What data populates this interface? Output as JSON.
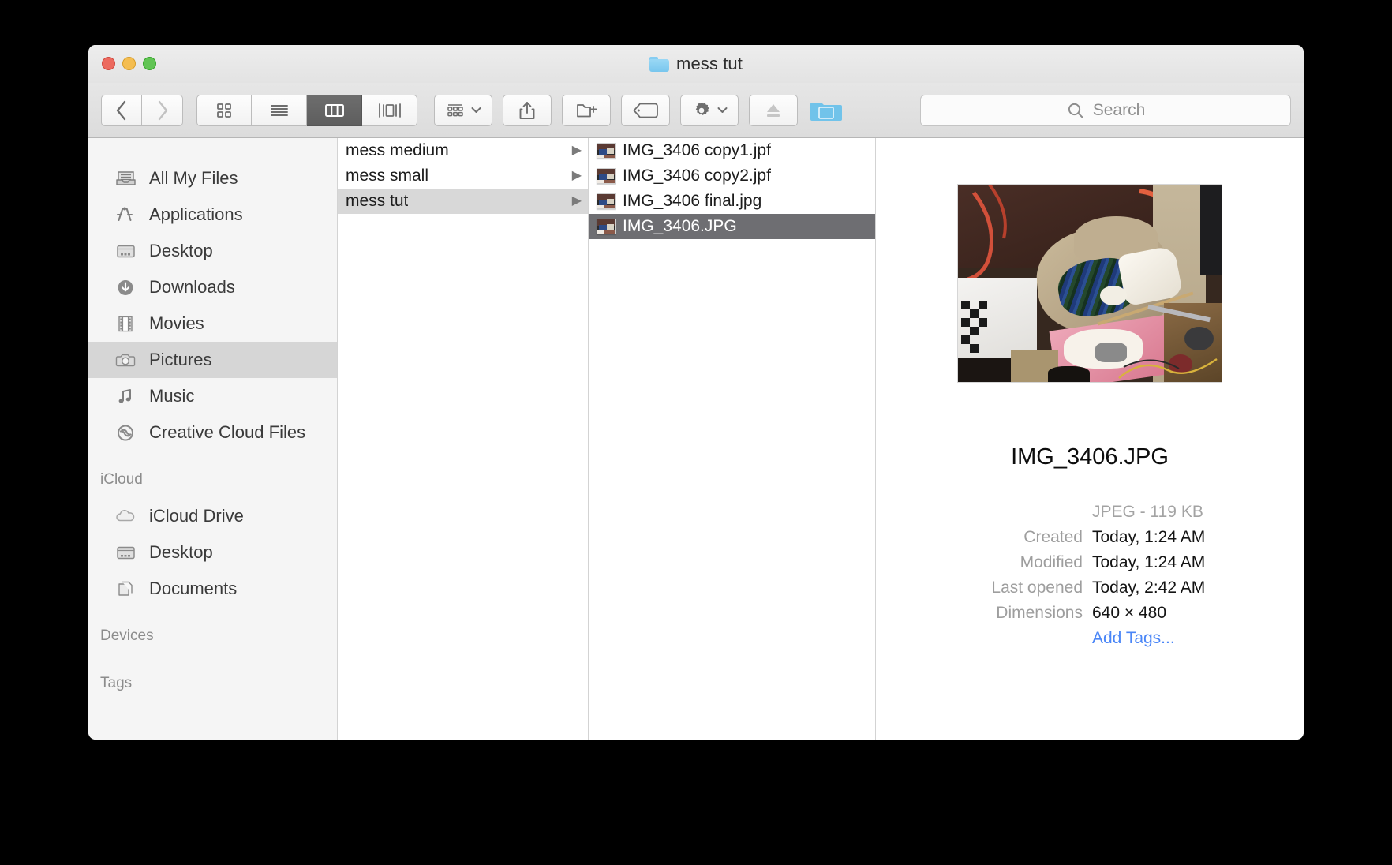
{
  "window": {
    "title": "mess tut",
    "title_icon": "folder-icon",
    "traffic_lights": [
      "close-button",
      "minimize-button",
      "zoom-button"
    ]
  },
  "toolbar": {
    "back_label": "‹",
    "forward_label": "›",
    "view_icon_grid": "icon-view-icon",
    "view_icon_list": "list-view-icon",
    "view_icon_column": "column-view-icon",
    "view_icon_coverflow": "coverflow-view-icon",
    "arrange_label": "arrange-icon",
    "share_label": "share-icon",
    "new_folder_label": "new-folder-icon",
    "tag_label": "tag-icon",
    "action_label": "gear-icon",
    "eject_label": "eject-icon",
    "dropbox_label": "folder-icon",
    "active_view": "column"
  },
  "search": {
    "placeholder": "Search",
    "value": "",
    "icon": "search-icon"
  },
  "sidebar": {
    "sections": [
      {
        "header": "",
        "items": [
          {
            "label": "All My Files",
            "icon": "all-my-files-icon",
            "selected": false
          },
          {
            "label": "Applications",
            "icon": "applications-icon",
            "selected": false
          },
          {
            "label": "Desktop",
            "icon": "desktop-icon",
            "selected": false
          },
          {
            "label": "Downloads",
            "icon": "downloads-icon",
            "selected": false
          },
          {
            "label": "Movies",
            "icon": "movies-icon",
            "selected": false
          },
          {
            "label": "Pictures",
            "icon": "pictures-icon",
            "selected": true
          },
          {
            "label": "Music",
            "icon": "music-icon",
            "selected": false
          },
          {
            "label": "Creative Cloud Files",
            "icon": "creative-cloud-icon",
            "selected": false
          }
        ]
      },
      {
        "header": "iCloud",
        "items": [
          {
            "label": "iCloud Drive",
            "icon": "icloud-drive-icon",
            "selected": false
          },
          {
            "label": "Desktop",
            "icon": "desktop-icon",
            "selected": false
          },
          {
            "label": "Documents",
            "icon": "documents-icon",
            "selected": false
          }
        ]
      },
      {
        "header": "Devices",
        "items": []
      },
      {
        "header": "Tags",
        "items": []
      }
    ]
  },
  "columns": {
    "folders": [
      {
        "name": "mess medium",
        "has_children": true,
        "selected": false
      },
      {
        "name": "mess small",
        "has_children": true,
        "selected": false
      },
      {
        "name": "mess tut",
        "has_children": true,
        "selected": true
      }
    ],
    "files": [
      {
        "name": "IMG_3406 copy1.jpf",
        "icon": "image-thumbnail",
        "selected": false
      },
      {
        "name": "IMG_3406 copy2.jpf",
        "icon": "image-thumbnail",
        "selected": false
      },
      {
        "name": "IMG_3406 final.jpg",
        "icon": "image-thumbnail",
        "selected": false
      },
      {
        "name": "IMG_3406.JPG",
        "icon": "image-thumbnail",
        "selected": true
      }
    ],
    "disclosure_glyph": "▶"
  },
  "preview": {
    "image_alt": "photo of a cluttered messy room",
    "file_name": "IMG_3406.JPG",
    "kind_and_size": "JPEG - 119 KB",
    "rows": [
      {
        "key": "Created",
        "value": "Today, 1:24 AM"
      },
      {
        "key": "Modified",
        "value": "Today, 1:24 AM"
      },
      {
        "key": "Last opened",
        "value": "Today, 2:42 AM"
      },
      {
        "key": "Dimensions",
        "value": "640 × 480"
      }
    ],
    "add_tags_label": "Add Tags..."
  },
  "colors": {
    "selection_active": "#6e6e72",
    "selection_inactive": "#d6d6d6",
    "link": "#4a86f7",
    "accent_folder": "#8fd0f0"
  }
}
